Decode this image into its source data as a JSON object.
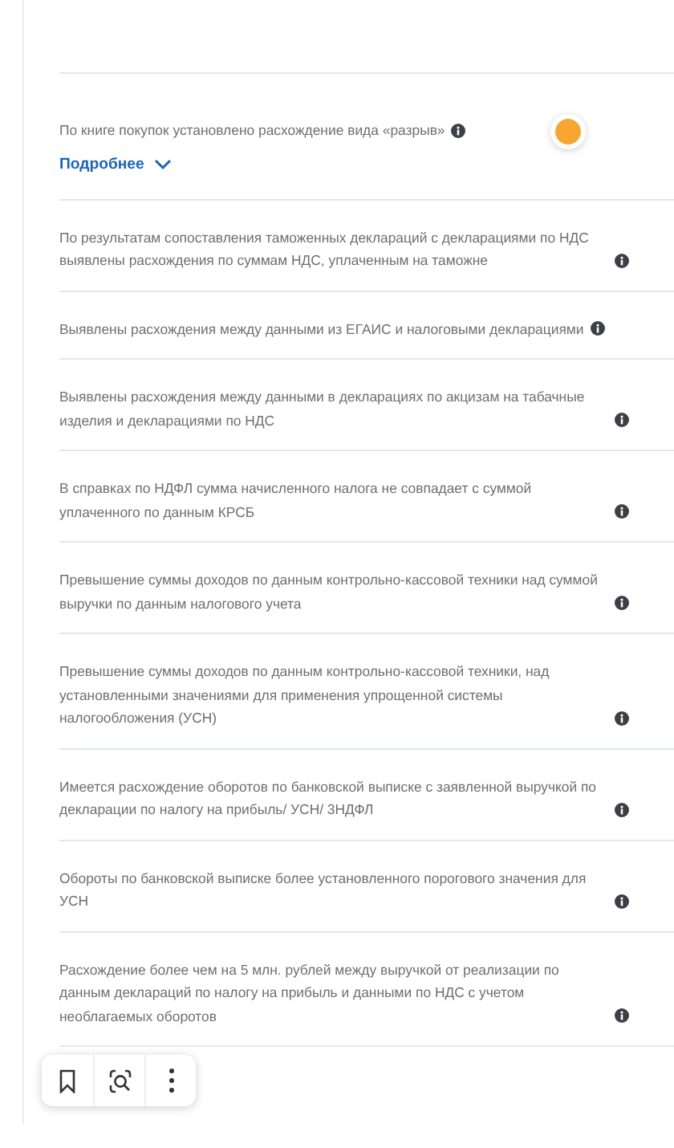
{
  "checks": [
    {
      "text": "По книге покупок установлено расхождение вида «разрыв»",
      "details": {
        "label": "Подробнее",
        "expanded": false
      },
      "status": {
        "color": "#f7a632"
      }
    },
    {
      "text": "По результатам сопоставления таможенных деклараций с декларациями по НДС выявлены расхождения по суммам НДС, уплаченным на таможне"
    },
    {
      "text": "Выявлены расхождения между данными из ЕГАИС и налоговыми декларациями"
    },
    {
      "text": "Выявлены расхождения между данными в декларациях по акцизам на табачные изделия и декларациями по НДС"
    },
    {
      "text": "В справках по НДФЛ сумма начисленного налога не совпадает с суммой уплаченного по данным КРСБ"
    },
    {
      "text": "Превышение суммы доходов по данным контрольно-кассовой техники над суммой выручки по данным налогового учета"
    },
    {
      "text": "Превышение суммы доходов по данным контрольно-кассовой техники, над установленными значениями для применения упрощенной системы налогообложения (УСН)"
    },
    {
      "text": "Имеется расхождение оборотов по банковской выписке с заявленной выручкой по декларации по налогу на прибыль/ УСН/ 3НДФЛ"
    },
    {
      "text": "Обороты по банковской выписке более установленного порогового значения для УСН"
    },
    {
      "text": "Расхождение более чем на 5 млн. рублей между выручкой от реализации по данным деклараций по налогу на прибыль и данными по НДС с учетом необлагаемых оборотов"
    }
  ]
}
